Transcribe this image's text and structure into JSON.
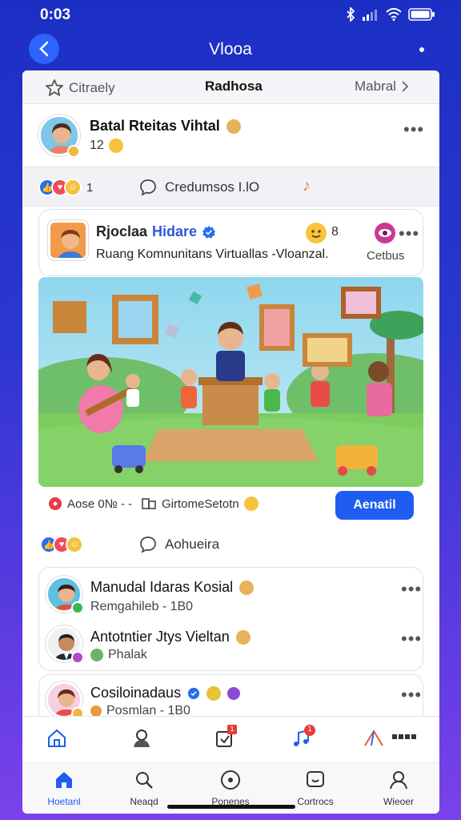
{
  "status": {
    "time": "0:03"
  },
  "nav": {
    "title": "Vlooa"
  },
  "tabs": {
    "left": "Citraely",
    "center": "Radhosa",
    "right": "Mabral"
  },
  "post": {
    "name": "Batal Rteitas Vihtal",
    "sub": "12"
  },
  "reactions": {
    "count": "1",
    "comment_label": "Credumsos I.lO"
  },
  "card": {
    "author_first": "Rjoclaa",
    "author_second": "Hidare",
    "subtitle": "Ruang Komnunitans Virtuallas -Vloanzal.",
    "emoji_count": "8",
    "side_label": "Cetbus"
  },
  "actions": {
    "left": "Aose 0№ - -",
    "middle": "GirtomeSetotn",
    "cta": "Aenatil"
  },
  "reactions2": {
    "comment_label": "Aohueira"
  },
  "list": [
    {
      "name": "Manudal Idaras Kosial",
      "sub": "Remgahileb - 1B0"
    },
    {
      "name": "Antotntier Jtys Vieltan",
      "sub": "Phalak"
    },
    {
      "name": "Cosiloinadaus",
      "sub": "Posmlan - 1B0"
    }
  ],
  "tabbar": {
    "items": [
      {
        "label": "Hoetanl"
      },
      {
        "label": "Neaqd"
      },
      {
        "label": "Ponenes"
      },
      {
        "label": "Cortrocs"
      },
      {
        "label": "Wieoer"
      }
    ]
  },
  "icon_row": {
    "badge_a": "1",
    "badge_b": "1"
  },
  "colors": {
    "accent": "#1f5df2",
    "background_top": "#1c2fc4",
    "background_bottom": "#7a42e8"
  }
}
